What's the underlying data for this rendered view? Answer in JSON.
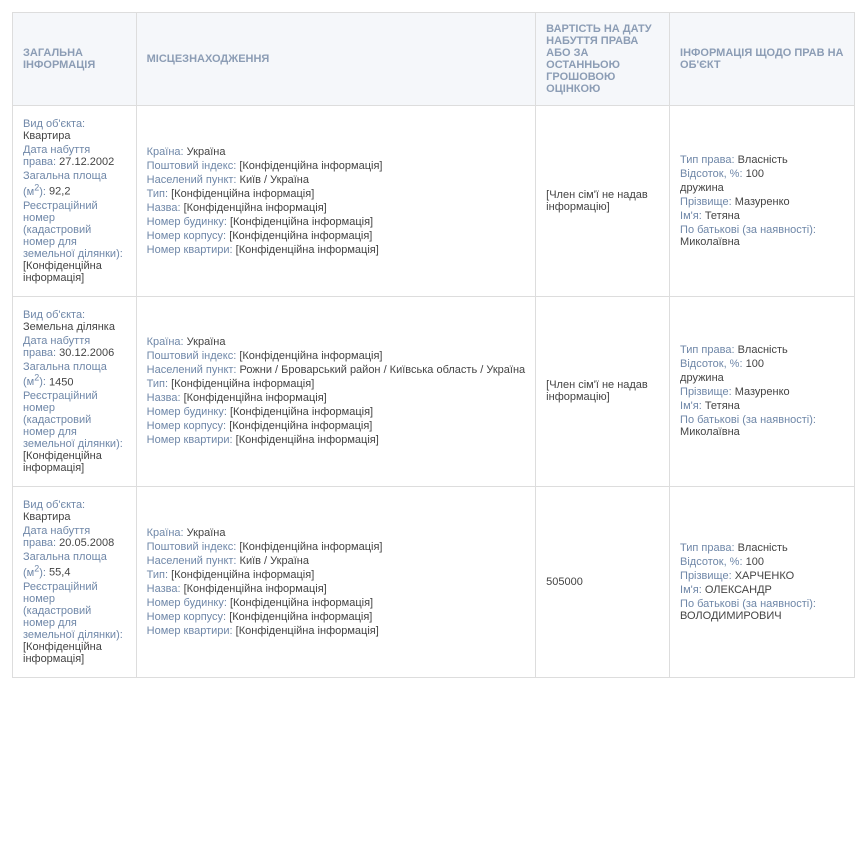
{
  "headers": {
    "c1": "ЗАГАЛЬНА ІНФОРМАЦІЯ",
    "c2": "МІСЦЕЗНАХОДЖЕННЯ",
    "c3": "ВАРТІСТЬ НА ДАТУ НАБУТТЯ ПРАВА АБО ЗА ОСТАННЬОЮ ГРОШОВОЮ ОЦІНКОЮ",
    "c4": "ІНФОРМАЦІЯ ЩОДО ПРАВ НА ОБ'ЄКТ"
  },
  "labels": {
    "vyd": "Вид об'єкта:",
    "data": "Дата набуття права:",
    "plosha": "Загальна площа (м",
    "plosha2": "):",
    "reestr": "Реєстраційний номер (кадастровий номер для земельної ділянки):",
    "kraina": "Країна:",
    "post": "Поштовий індекс:",
    "nasp": "Населений пункт:",
    "typ": "Тип:",
    "nazva": "Назва:",
    "nbud": "Номер будинку:",
    "nkorp": "Номер корпусу:",
    "nkv": "Номер квартири:",
    "typp": "Тип права:",
    "vids": "Відсоток, %:",
    "prizv": "Прізвище:",
    "imya": "Ім'я:",
    "pobat": "По батькові (за наявності):"
  },
  "conf": "[Конфіденційна інформація]",
  "nodata": "[Член сім'ї не надав інформацію]",
  "ua": "Україна",
  "rows": [
    {
      "vyd": "Квартира",
      "data": "27.12.2002",
      "plosha": "92,2",
      "nasp": "Київ / Україна",
      "cost": "",
      "typp": "Власність",
      "vids": "100",
      "extra": "дружина",
      "prizv": "Мазуренко",
      "imya": "Тетяна",
      "pobat": "Миколаївна"
    },
    {
      "vyd": "Земельна ділянка",
      "data": "30.12.2006",
      "plosha": "1450",
      "nasp": "Рожни / Броварський район / Київська область / Україна",
      "cost": "",
      "typp": "Власність",
      "vids": "100",
      "extra": "дружина",
      "prizv": "Мазуренко",
      "imya": "Тетяна",
      "pobat": "Миколаївна"
    },
    {
      "vyd": "Квартира",
      "data": "20.05.2008",
      "plosha": "55,4",
      "nasp": "Київ / Україна",
      "cost": "505000",
      "typp": "Власність",
      "vids": "100",
      "extra": "",
      "prizv": "ХАРЧЕНКО",
      "imya": "ОЛЕКСАНДР",
      "pobat": "ВОЛОДИМИРОВИЧ"
    }
  ]
}
